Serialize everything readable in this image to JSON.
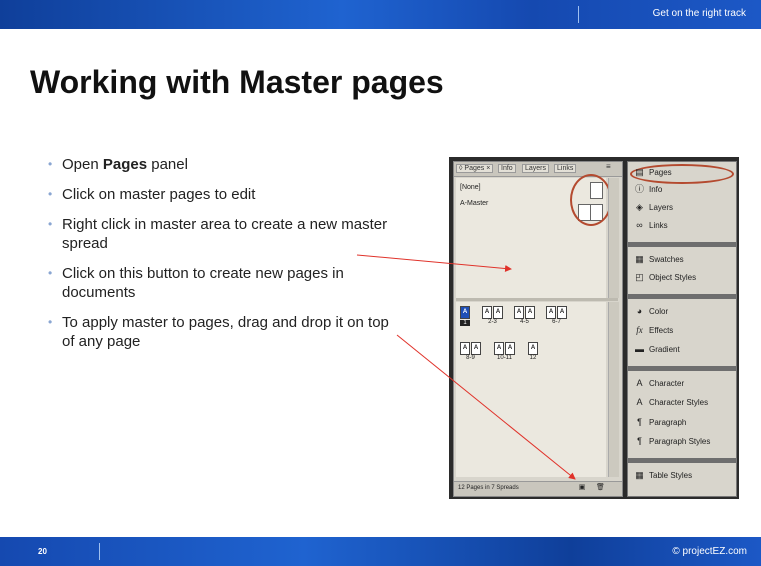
{
  "header": {
    "tag": "Get on the right track"
  },
  "slide": {
    "title": "Working with Master pages",
    "bullets": [
      {
        "pre": "Open ",
        "bold": "Pages",
        "post": " panel"
      },
      {
        "text": "Click on master pages to edit"
      },
      {
        "text": "Right click in master area to create a new master spread"
      },
      {
        "text": "Click on this button to create new pages in documents"
      },
      {
        "text": "To apply master to pages, drag and drop it on top of any page"
      }
    ]
  },
  "panel": {
    "tabs": [
      "◊ Pages ×",
      "Info",
      "Layers",
      "Links"
    ],
    "masters": [
      "[None]",
      "A-Master"
    ],
    "spreads": [
      "1",
      "2-3",
      "4-5",
      "6-7",
      "8-9",
      "10-11",
      "12"
    ],
    "master_letter": "A",
    "status": "12 Pages in 7 Spreads"
  },
  "sidebar": {
    "items": [
      "Pages",
      "Info",
      "Layers",
      "Links",
      "Swatches",
      "Object Styles",
      "Color",
      "Effects",
      "Gradient",
      "Character",
      "Character Styles",
      "Paragraph",
      "Paragraph Styles",
      "Table Styles"
    ]
  },
  "footer": {
    "page_number": "20",
    "copyright": "© projectEZ.com"
  },
  "colors": {
    "bar_blue": "#1f63d0",
    "highlight_red": "#b44a2f",
    "arrow_red": "#e0322a"
  }
}
